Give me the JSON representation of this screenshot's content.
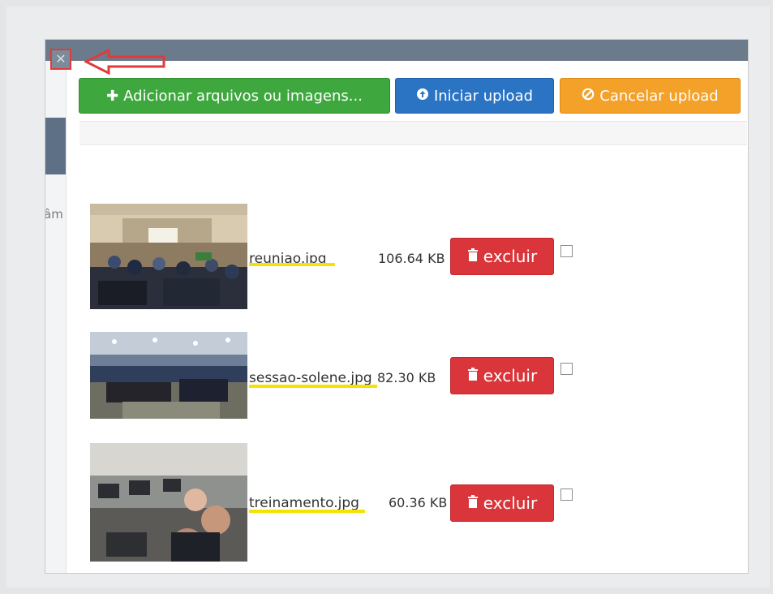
{
  "toolbar": {
    "add_label": "Adicionar arquivos ou imagens...",
    "start_label": "Iniciar upload",
    "cancel_label": "Cancelar upload",
    "add_icon": "plus-icon",
    "start_icon": "upload-circle-icon",
    "cancel_icon": "ban-icon"
  },
  "background_fragment": "âm",
  "files": [
    {
      "name": "reuniao.jpg",
      "size": "106.64 KB",
      "delete_label": "excluir",
      "thumbnail": "meeting-room-photo"
    },
    {
      "name": "sessao-solene.jpg",
      "size": "82.30 KB",
      "delete_label": "excluir",
      "thumbnail": "auditorium-session-photo"
    },
    {
      "name": "treinamento.jpg",
      "size": "60.36 KB",
      "delete_label": "excluir",
      "thumbnail": "training-room-photo"
    }
  ],
  "colors": {
    "add": "#3ea83e",
    "start": "#2b74c4",
    "cancel": "#f4a12a",
    "delete": "#d9353a",
    "highlight": "#f4e200",
    "annotation": "#e03a3a"
  }
}
